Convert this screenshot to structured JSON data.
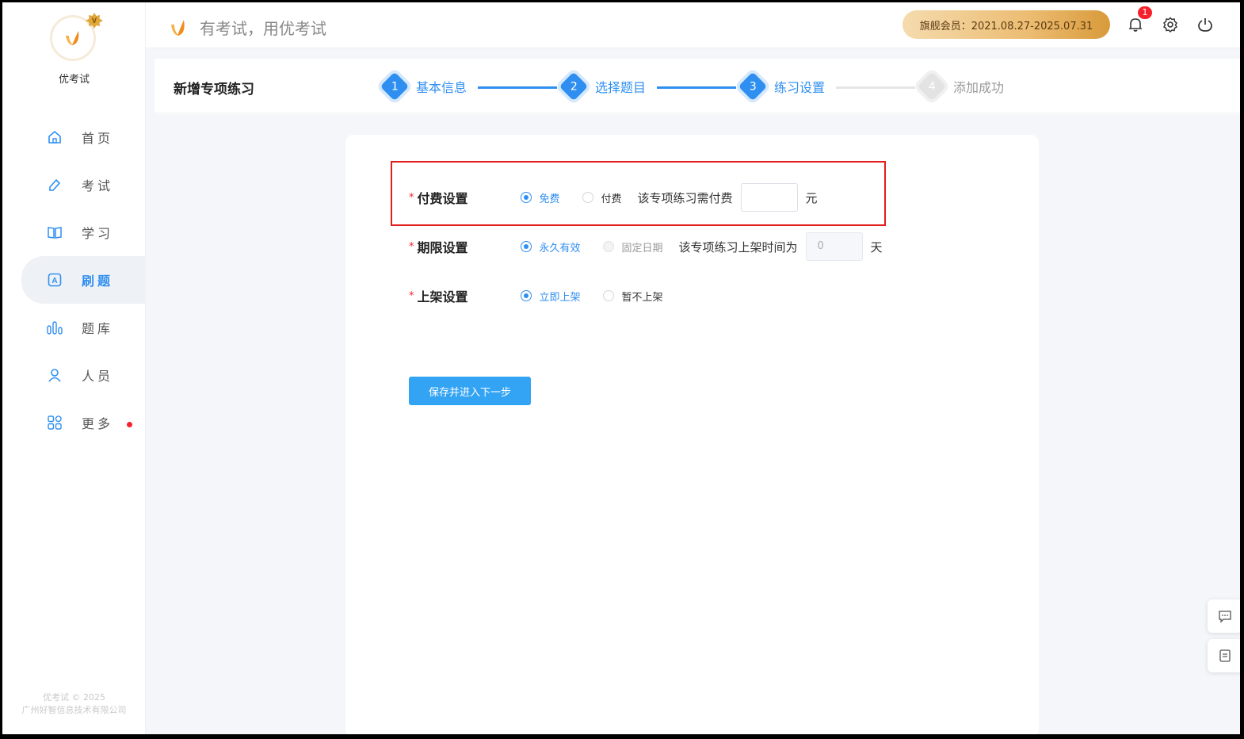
{
  "app": {
    "name": "优考试",
    "slogan": "有考试，用优考试"
  },
  "sidebar": {
    "items": [
      {
        "label": "首页",
        "icon": "home-icon"
      },
      {
        "label": "考试",
        "icon": "exam-icon"
      },
      {
        "label": "学习",
        "icon": "book-icon"
      },
      {
        "label": "刷题",
        "icon": "practice-icon"
      },
      {
        "label": "题库",
        "icon": "question-bank-icon"
      },
      {
        "label": "人员",
        "icon": "user-icon"
      },
      {
        "label": "更多",
        "icon": "apps-icon"
      }
    ],
    "active": "刷题",
    "copyright_line1": "优考试 © 2025",
    "copyright_line2": "广州好智信息技术有限公司"
  },
  "header": {
    "vip_label": "旗舰会员：2021.08.27-2025.07.31",
    "notification_count": "1"
  },
  "page": {
    "title": "新增专项练习",
    "steps": [
      {
        "num": "1",
        "label": "基本信息",
        "state": "done"
      },
      {
        "num": "2",
        "label": "选择题目",
        "state": "done"
      },
      {
        "num": "3",
        "label": "练习设置",
        "state": "current"
      },
      {
        "num": "4",
        "label": "添加成功",
        "state": "pending"
      }
    ]
  },
  "form": {
    "fee": {
      "required_mark": "*",
      "label": "付费设置",
      "options": [
        "免费",
        "付费"
      ],
      "selected": "免费",
      "price_prefix": "该专项练习需付费",
      "price_value": "",
      "unit": "元"
    },
    "period": {
      "required_mark": "*",
      "label": "期限设置",
      "options": [
        "永久有效",
        "固定日期"
      ],
      "selected": "永久有效",
      "duration_prefix": "该专项练习上架时间为",
      "duration_value": "0",
      "unit": "天"
    },
    "listing": {
      "required_mark": "*",
      "label": "上架设置",
      "options": [
        "立即上架",
        "暂不上架"
      ],
      "selected": "立即上架"
    },
    "save_button": "保存并进入下一步"
  },
  "colors": {
    "primary": "#2f8ff0",
    "highlight_border": "#e11d1d",
    "vip_gradient_start": "#f5dbae",
    "vip_gradient_end": "#d99a3a"
  }
}
